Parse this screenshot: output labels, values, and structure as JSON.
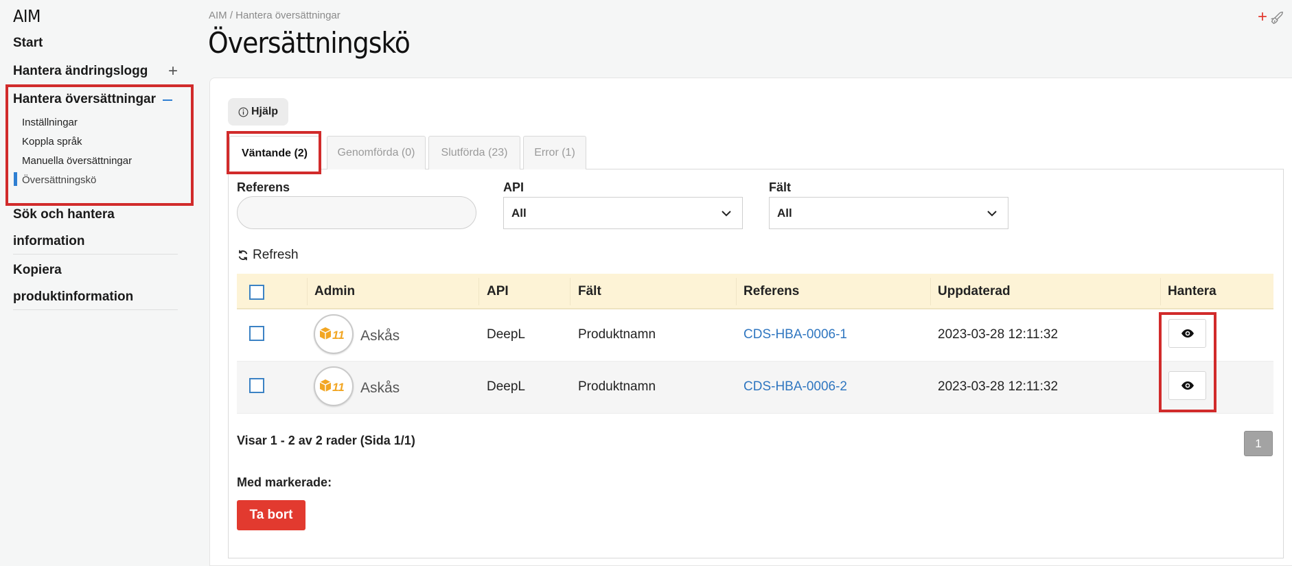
{
  "app": {
    "brand": "AIM"
  },
  "sidebar": {
    "items": [
      {
        "label": "Start"
      },
      {
        "label": "Hantera ändringslogg"
      },
      {
        "label": "Hantera översättningar"
      },
      {
        "label_line1": "Sök och hantera",
        "label_line2": "information"
      },
      {
        "label_line1": "Kopiera",
        "label_line2": "produktinformation"
      }
    ],
    "subitems": [
      {
        "label": "Inställningar"
      },
      {
        "label": "Koppla språk"
      },
      {
        "label": "Manuella översättningar"
      },
      {
        "label": "Översättningskö"
      }
    ],
    "active_color": "#2f7fd2"
  },
  "header": {
    "breadcrumb": "AIM / Hantera översättningar",
    "title": "Översättningskö"
  },
  "help": {
    "label": "Hjälp"
  },
  "tabs": [
    {
      "label": "Väntande (2)"
    },
    {
      "label": "Genomförda (0)"
    },
    {
      "label": "Slutförda (23)"
    },
    {
      "label": "Error (1)"
    }
  ],
  "filters": {
    "referens": {
      "label": "Referens",
      "value": ""
    },
    "api": {
      "label": "API",
      "value": "All"
    },
    "falt": {
      "label": "Fält",
      "value": "All"
    }
  },
  "refresh": {
    "label": "Refresh"
  },
  "table": {
    "headers": [
      "Admin",
      "API",
      "Fält",
      "Referens",
      "Uppdaterad",
      "Hantera"
    ],
    "rows": [
      {
        "admin": "Askås",
        "api": "DeepL",
        "falt": "Produktnamn",
        "referens": "CDS-HBA-0006-1",
        "uppdaterad": "2023-03-28 12:11:32"
      },
      {
        "admin": "Askås",
        "api": "DeepL",
        "falt": "Produktnamn",
        "referens": "CDS-HBA-0006-2",
        "uppdaterad": "2023-03-28 12:11:32"
      }
    ]
  },
  "pagination": {
    "summary": "Visar 1 - 2 av 2 rader (Sida 1/1)",
    "current_page": "1"
  },
  "bulk": {
    "label": "Med markerade:",
    "delete_label": "Ta bort"
  },
  "colors": {
    "highlight": "#d12b2b",
    "danger": "#e23a2f",
    "link": "#2f76c0",
    "table_header": "#fdf3d6"
  }
}
